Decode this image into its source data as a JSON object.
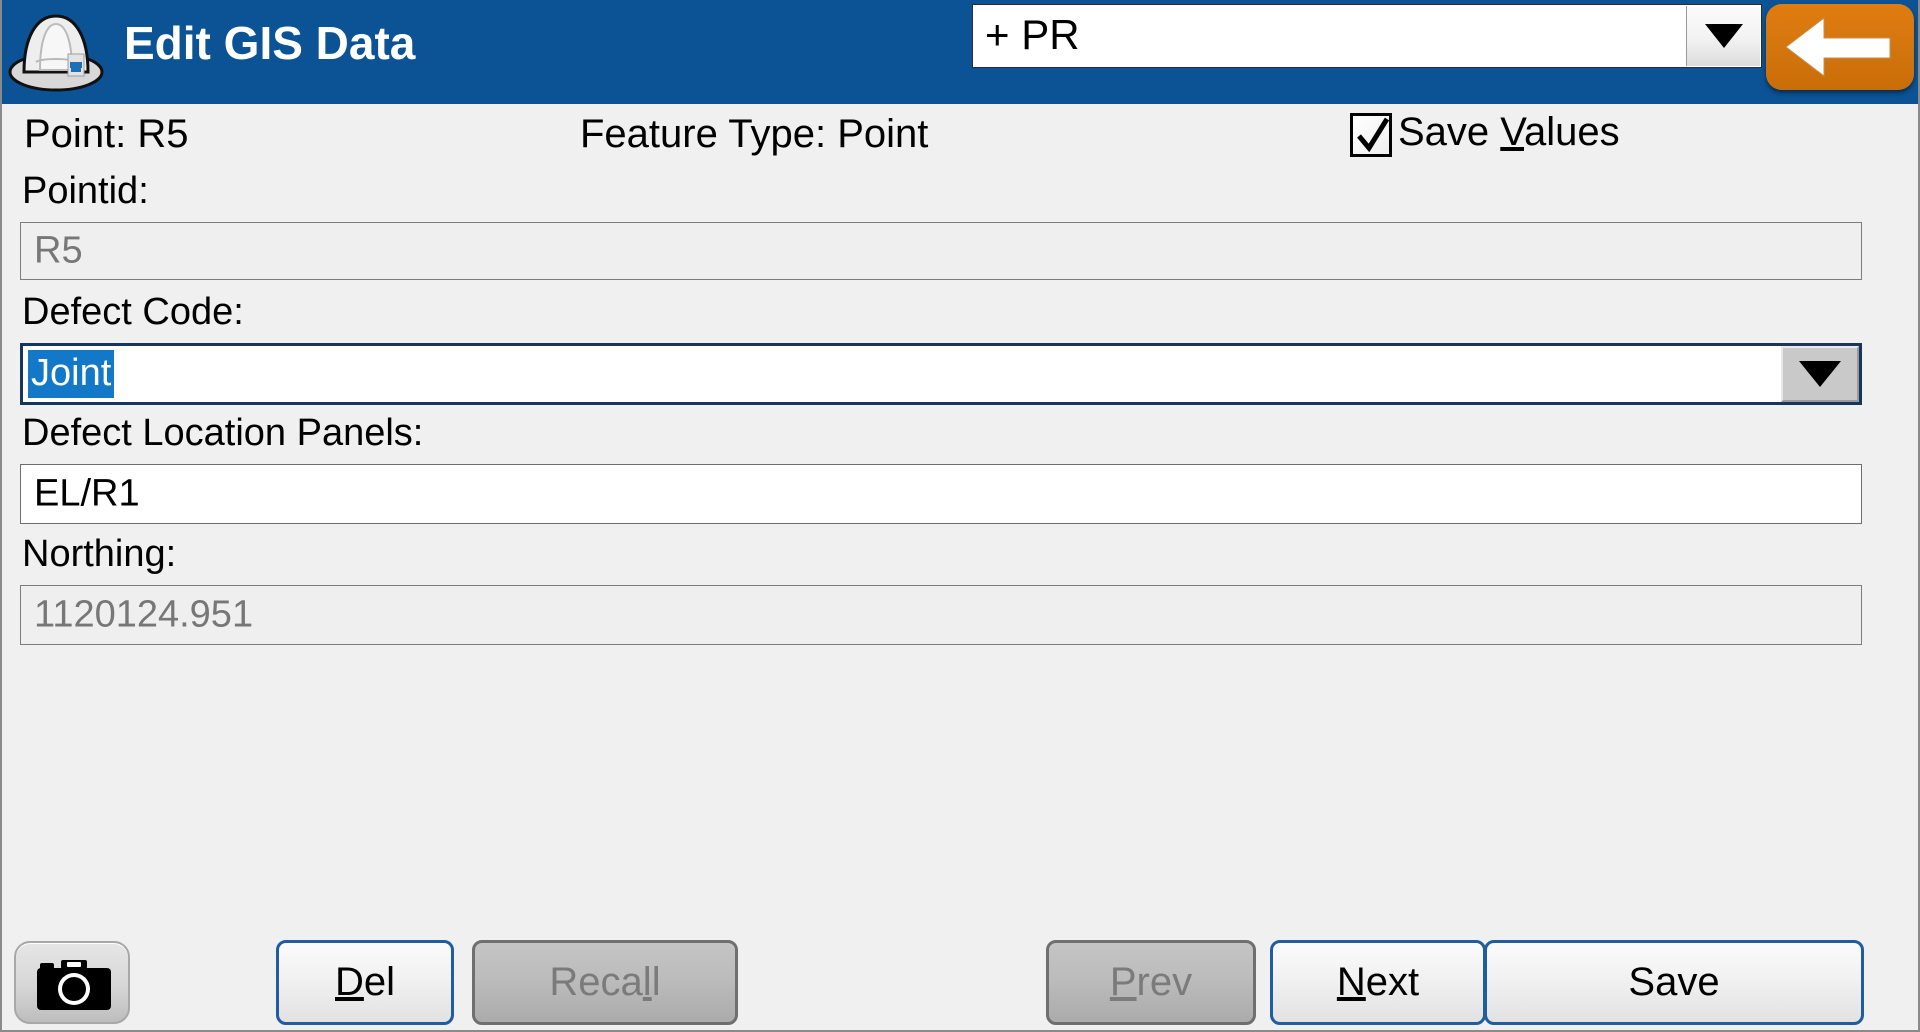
{
  "window": {
    "title": "Edit GIS Data",
    "icon": "hardhat-icon",
    "header_color": "#0b5394",
    "accent_orange": "#d4760e"
  },
  "header": {
    "project_select": {
      "value": "+ PR",
      "dropdown_icon": "chevron-down-icon"
    },
    "back_button": {
      "icon": "arrow-left-icon",
      "label": ""
    }
  },
  "info": {
    "point_label": "Point: R5",
    "feature_type_label": "Feature Type: Point",
    "save_values": {
      "label_before": "Save ",
      "accel": "V",
      "label_after": "alues",
      "checked": true,
      "check_icon": "checkmark-icon"
    }
  },
  "fields": [
    {
      "label": "Pointid:",
      "value": "R5",
      "type": "text",
      "enabled": false
    },
    {
      "label": "Defect Code:",
      "value": "Joint",
      "type": "combobox",
      "enabled": true,
      "focused": true,
      "selected": true,
      "selection_bg": "#1478c8",
      "dropdown_icon": "chevron-down-icon"
    },
    {
      "label": "Defect Location Panels:",
      "value": "EL/R1",
      "type": "text",
      "enabled": true
    },
    {
      "label": "Northing:",
      "value": "1120124.951",
      "type": "text",
      "enabled": false
    }
  ],
  "footer": {
    "camera_button": {
      "icon": "camera-icon",
      "enabled": true
    },
    "buttons": [
      {
        "name": "del",
        "before": "",
        "accel": "D",
        "after": "el",
        "enabled": true
      },
      {
        "name": "recall",
        "before": "Reca",
        "accel": "l",
        "after": "l",
        "enabled": false
      },
      {
        "name": "prev",
        "before": "",
        "accel": "P",
        "after": "rev",
        "enabled": false
      },
      {
        "name": "next",
        "before": "",
        "accel": "N",
        "after": "ext",
        "enabled": true
      },
      {
        "name": "save",
        "before": "Save",
        "accel": "",
        "after": "",
        "enabled": true
      }
    ]
  }
}
